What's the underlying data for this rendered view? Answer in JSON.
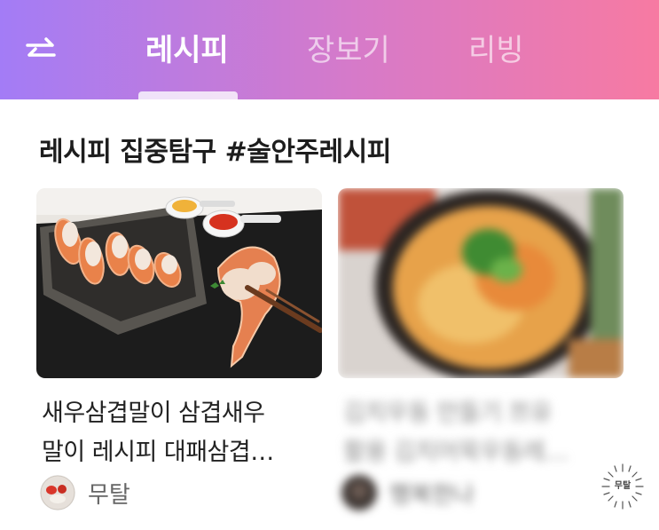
{
  "header": {
    "tabs": [
      {
        "label": "레시피",
        "active": true
      },
      {
        "label": "장보기",
        "active": false
      },
      {
        "label": "리빙",
        "active": false
      }
    ],
    "swap_icon": "swap-arrows-icon"
  },
  "section": {
    "title": "레시피 집중탐구 #술안주레시피"
  },
  "cards": [
    {
      "title_line1": "새우삼겹말이 삼겹새우",
      "title_line2": "말이 레시피 대패삼겹…",
      "author": "무탈",
      "blurred": false
    },
    {
      "title_line1": "김치우동 만들기 쯔유",
      "title_line2": "활용 김치어묵우동레…",
      "author": "행복한나",
      "blurred": true
    }
  ],
  "watermark": {
    "text": "무탈"
  },
  "colors": {
    "gradient_start": "#a37cf6",
    "gradient_end": "#f77aa2"
  }
}
